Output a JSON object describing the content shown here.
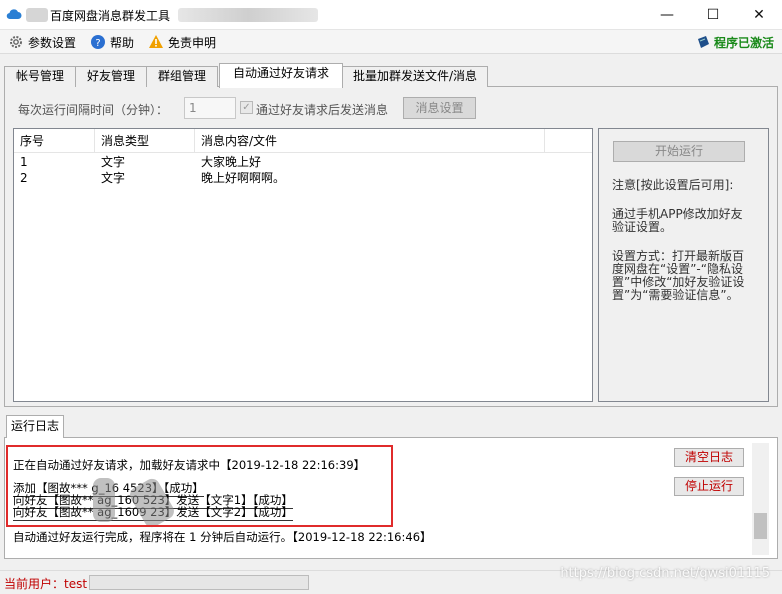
{
  "window": {
    "title": "百度网盘消息群发工具",
    "min_glyph": "—",
    "max_glyph": "☐",
    "close_glyph": "✕"
  },
  "menu": {
    "settings_label": "参数设置",
    "help_label": "帮助",
    "disclaimer_label": "免责申明",
    "status_label": "程序已激活"
  },
  "tabs": [
    {
      "label": "帐号管理"
    },
    {
      "label": "好友管理"
    },
    {
      "label": "群组管理"
    },
    {
      "label": "自动通过好友请求"
    },
    {
      "label": "批量加群发送文件/消息"
    }
  ],
  "panel": {
    "interval_label": "每次运行间隔时间（分钟）：",
    "interval_value": "1",
    "checkbox_label": "通过好友请求后发送消息",
    "checkbox_glyph": "✓",
    "msg_settings_button": "消息设置"
  },
  "table": {
    "columns": [
      "序号",
      "消息类型",
      "消息内容/文件"
    ],
    "rows": [
      {
        "no": "1",
        "type": "文字",
        "content": "大家晚上好"
      },
      {
        "no": "2",
        "type": "文字",
        "content": "晚上好啊啊啊。"
      }
    ]
  },
  "side": {
    "start_button": "开始运行",
    "note1": "注意[按此设置后可用]:",
    "note2": "通过手机APP修改加好友验证设置。",
    "note3": "设置方式：打开最新版百度网盘在“设置”-“隐私设置”中修改“加好友验证设置”为“需要验证信息”。"
  },
  "log": {
    "tab_label": "运行日志",
    "lines": [
      "正在自动通过好友请求，加载好友请求中【2019-12-18 22:16:39】",
      "添加【图故***    g_16    4523】【成功】",
      "向好友【图故**     ag_160     523】发送【文字1】【成功】",
      "向好友【图故**     ag_1609    23】发送【文字2】【成功】",
      "自动通过好友运行完成，程序将在 1 分钟后自动运行。【2019-12-18 22:16:46】"
    ],
    "clear_button": "清空日志",
    "stop_button": "停止运行"
  },
  "status": {
    "user_text": "当前用户：test",
    "watermark": "https://blog.csdn.net/qwsi01115"
  }
}
